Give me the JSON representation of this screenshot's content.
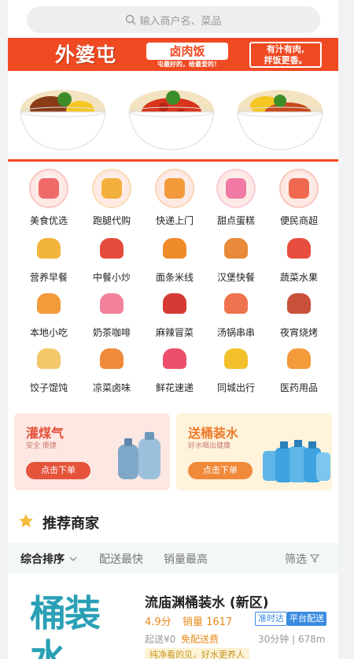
{
  "search": {
    "placeholder": "输入商户名、菜品"
  },
  "banner": {
    "brand": "外婆屯",
    "brand_sub": "卤肉饭",
    "brand_tag": "屯最好的，给最爱的！",
    "slogan_line1": "有汁有肉,",
    "slogan_line2": "拌饭更香。"
  },
  "categories": [
    {
      "label": "美食优选",
      "icon": "roast-chicken-icon",
      "color": "#f06a6a"
    },
    {
      "label": "跑腿代购",
      "icon": "shopping-bag-icon",
      "color": "#f4b03c"
    },
    {
      "label": "快递上门",
      "icon": "delivery-door-icon",
      "color": "#f29a3a"
    },
    {
      "label": "甜点蛋糕",
      "icon": "cake-icon",
      "color": "#f07aa4"
    },
    {
      "label": "便民商超",
      "icon": "store-icon",
      "color": "#f0684f"
    },
    {
      "label": "营养早餐",
      "icon": "dumpling-icon",
      "color": "#f2b43a"
    },
    {
      "label": "中餐小炒",
      "icon": "stir-fry-icon",
      "color": "#e44b3b"
    },
    {
      "label": "面条米线",
      "icon": "noodle-bowl-icon",
      "color": "#f08b2a"
    },
    {
      "label": "汉堡快餐",
      "icon": "burger-icon",
      "color": "#e8893b"
    },
    {
      "label": "蔬菜水果",
      "icon": "vegetable-icon",
      "color": "#e84e3e"
    },
    {
      "label": "本地小吃",
      "icon": "snack-icon",
      "color": "#f29b3a"
    },
    {
      "label": "奶茶咖啡",
      "icon": "milk-tea-icon",
      "color": "#f2829c"
    },
    {
      "label": "麻辣冒菜",
      "icon": "spicy-bowl-icon",
      "color": "#d63a34"
    },
    {
      "label": "汤锅串串",
      "icon": "hotpot-icon",
      "color": "#f0734f"
    },
    {
      "label": "夜宵烧烤",
      "icon": "bbq-skewer-icon",
      "color": "#c9513c"
    },
    {
      "label": "饺子馄饨",
      "icon": "jiaozi-icon",
      "color": "#f3c86a"
    },
    {
      "label": "凉菜卤味",
      "icon": "cold-dish-icon",
      "color": "#f08a3a"
    },
    {
      "label": "鲜花速递",
      "icon": "flower-icon",
      "color": "#ec4f6b"
    },
    {
      "label": "同城出行",
      "icon": "taxi-icon",
      "color": "#f2c02c"
    },
    {
      "label": "医药用品",
      "icon": "medicine-icon",
      "color": "#f39a3a"
    }
  ],
  "promos": [
    {
      "title": "灌煤气",
      "sub": "安全  便捷",
      "button": "点击下单",
      "title_color": "#e5533b",
      "bg": "#fde7e3",
      "btn_color": "#e5533b"
    },
    {
      "title": "送桶装水",
      "sub": "好水喝出健康",
      "button": "点击下单",
      "title_color": "#ee7a2b",
      "bg": "#fff3dc",
      "btn_color": "#f08a3a"
    }
  ],
  "section": {
    "title": "推荐商家"
  },
  "sort": {
    "items": [
      {
        "label": "综合排序",
        "active": true
      },
      {
        "label": "配送最快",
        "active": false
      },
      {
        "label": "销量最高",
        "active": false
      }
    ],
    "filter": "筛选"
  },
  "merchant": {
    "thumb_text": "桶装水",
    "name": "流庙渊桶装水 (新区)",
    "score": "4.9分",
    "sales": "销量 1617",
    "badges": [
      "准时达",
      "平台配送"
    ],
    "fee": "起送¥0",
    "free_fee": "免配送费",
    "distance": "30分钟 | 678m",
    "tagline": "纯净看的见，好水更养人"
  }
}
